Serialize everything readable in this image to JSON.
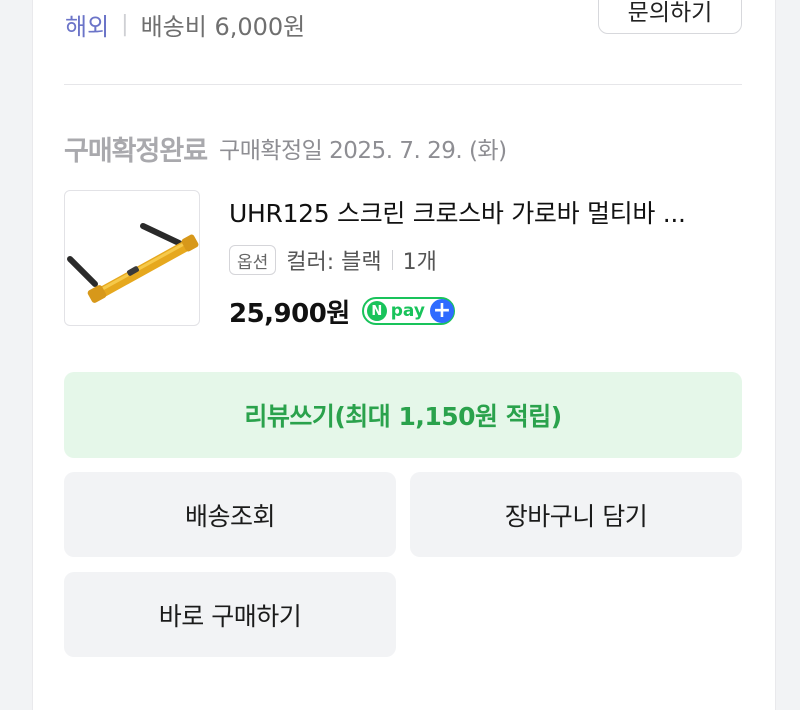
{
  "shipping": {
    "origin": "해외",
    "fee": "배송비 6,000원",
    "inquiry_label": "문의하기"
  },
  "order": {
    "status": "구매확정완료",
    "confirm_date": "구매확정일 2025. 7. 29. (화)"
  },
  "product": {
    "name": "UHR125 스크린 크로스바 가로바 멀티바 ...",
    "option_badge": "옵션",
    "option_value": "컬러: 블랙",
    "quantity": "1개",
    "price": "25,900원",
    "pay_badge": "pay",
    "pay_badge_n": "N",
    "image_icon": "crossbar-product-image"
  },
  "actions": {
    "review": "리뷰쓰기(최대 1,150원 적립)",
    "track": "배송조회",
    "cart": "장바구니 담기",
    "buy_now": "바로 구매하기"
  },
  "colors": {
    "accent_green": "#2aa24c",
    "review_bg": "#e5f7e9",
    "npay_green": "#19c35b",
    "npay_blue": "#2f6bff"
  }
}
